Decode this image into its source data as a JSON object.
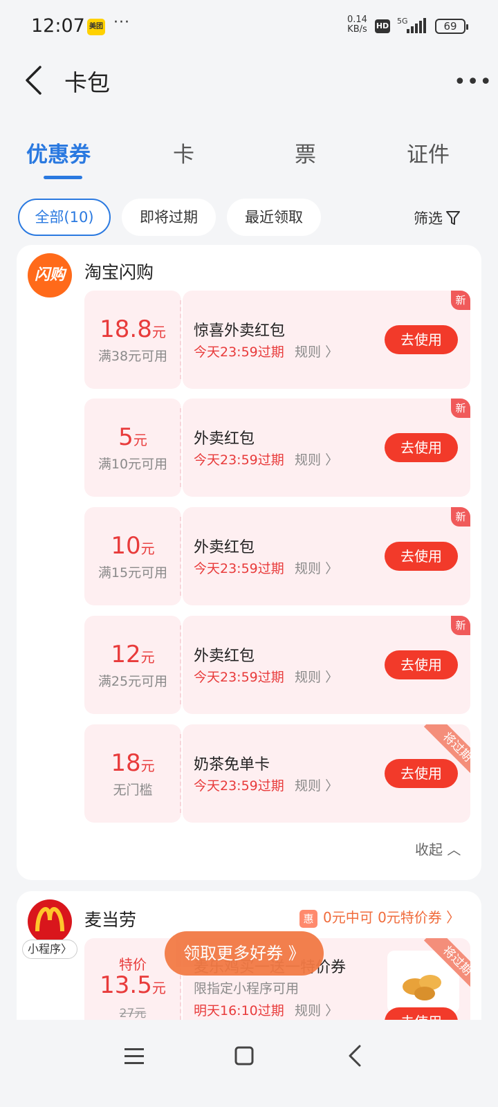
{
  "status_bar": {
    "time": "12:07",
    "app_badge": "美团",
    "dots": "···",
    "net_speed_value": "0.14",
    "net_speed_unit": "KB/s",
    "hd": "HD",
    "network": "5G",
    "battery": "69"
  },
  "navbar": {
    "title": "卡包",
    "more": "•••"
  },
  "tabs": [
    {
      "label": "优惠券"
    },
    {
      "label": "卡"
    },
    {
      "label": "票"
    },
    {
      "label": "证件"
    }
  ],
  "filters": {
    "chips": [
      {
        "label": "全部(10)"
      },
      {
        "label": "即将过期"
      },
      {
        "label": "最近领取"
      }
    ],
    "filter_label": "筛选"
  },
  "taobao": {
    "brand": "淘宝闪购",
    "logo_text": "闪购",
    "coupons": [
      {
        "amount": "18.8",
        "unit": "元",
        "condition": "满38元可用",
        "title": "惊喜外卖红包",
        "expire": "今天23:59过期",
        "rule": "规则",
        "button": "去使用",
        "tag": "新"
      },
      {
        "amount": "5",
        "unit": "元",
        "condition": "满10元可用",
        "title": "外卖红包",
        "expire": "今天23:59过期",
        "rule": "规则",
        "button": "去使用",
        "tag": "新"
      },
      {
        "amount": "10",
        "unit": "元",
        "condition": "满15元可用",
        "title": "外卖红包",
        "expire": "今天23:59过期",
        "rule": "规则",
        "button": "去使用",
        "tag": "新"
      },
      {
        "amount": "12",
        "unit": "元",
        "condition": "满25元可用",
        "title": "外卖红包",
        "expire": "今天23:59过期",
        "rule": "规则",
        "button": "去使用",
        "tag": "新"
      },
      {
        "amount": "18",
        "unit": "元",
        "condition": "无门槛",
        "title": "奶茶免单卡",
        "expire": "今天23:59过期",
        "rule": "规则",
        "button": "去使用",
        "tag": "将过期"
      }
    ],
    "collapse": "收起"
  },
  "mcd": {
    "brand": "麦当劳",
    "mini_program": "小程序",
    "promo_icon": "惠",
    "promo": "0元中可 0元特价券",
    "coupon": {
      "price_label": "特价",
      "amount": "13.5",
      "unit": "元",
      "original": "27元",
      "title": "麦乐鸡买一送一特价券",
      "subtitle": "限指定小程序可用",
      "expire": "明天16:10过期",
      "rule": "规则",
      "button": "去使用",
      "tag": "将过期"
    }
  },
  "float_button": "领取更多好券 》",
  "colors": {
    "accent": "#2a79e0",
    "coupon_red": "#e83b3b",
    "button_red": "#f23a2a",
    "coupon_bg": "#feeff1"
  }
}
